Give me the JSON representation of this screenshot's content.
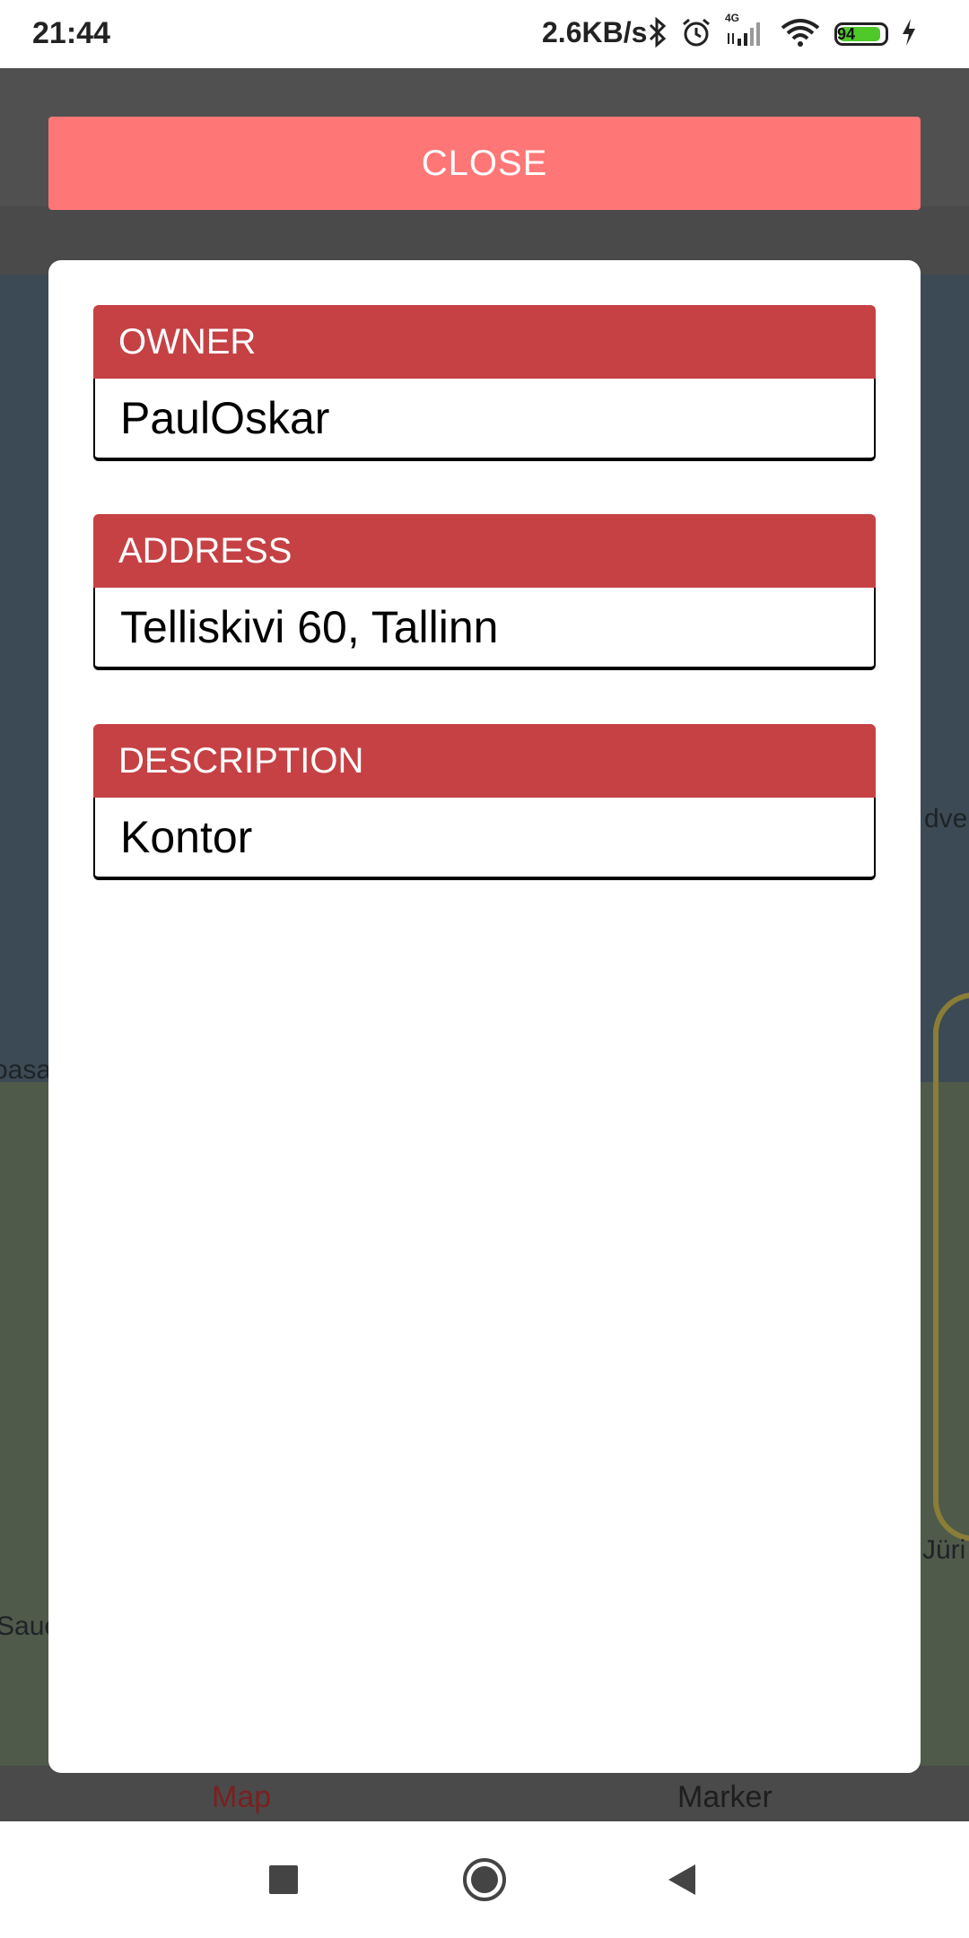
{
  "status_bar": {
    "time": "21:44",
    "speed": "2.6KB/s",
    "network": "4G",
    "battery": "94"
  },
  "close_button": {
    "label": "CLOSE"
  },
  "fields": [
    {
      "label": "OWNER",
      "value": "PaulOskar"
    },
    {
      "label": "ADDRESS",
      "value": "Telliskivi 60, Tallinn"
    },
    {
      "label": "DESCRIPTION",
      "value": "Kontor"
    }
  ],
  "map_labels": [
    "dve",
    "oasa",
    "Jüri",
    "Saue"
  ],
  "bottom_nav": {
    "map": "Map",
    "marker": "Marker"
  },
  "colors": {
    "close_button": "#ff7676",
    "field_header": "#c64144",
    "battery": "#4fc92a"
  }
}
